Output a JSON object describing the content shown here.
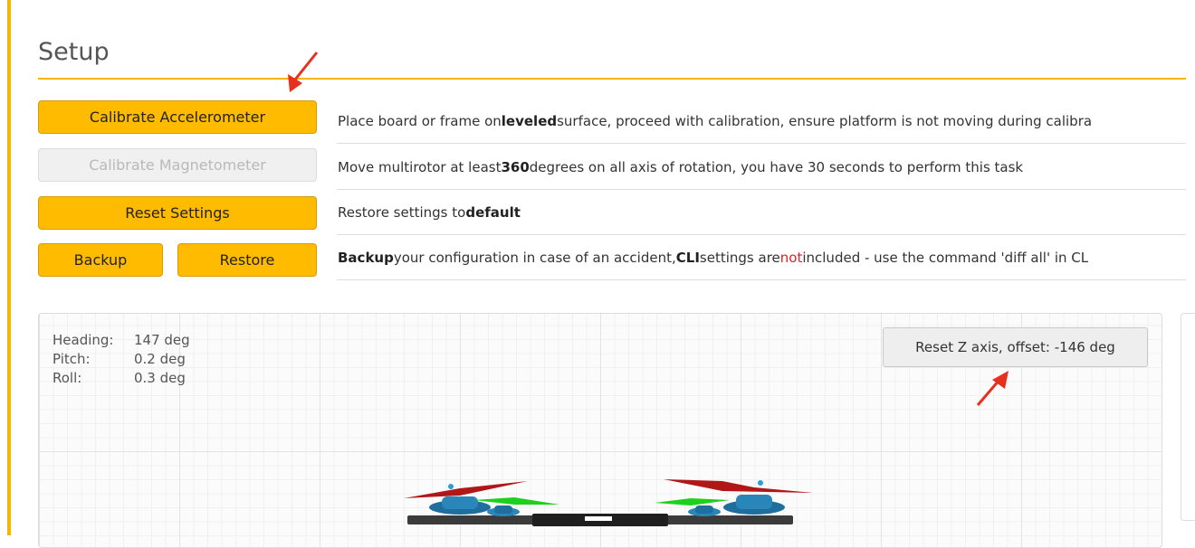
{
  "page": {
    "title": "Setup"
  },
  "buttons": {
    "calibrate_accel": "Calibrate Accelerometer",
    "calibrate_mag": "Calibrate Magnetometer",
    "reset_settings": "Reset Settings",
    "backup": "Backup",
    "restore": "Restore"
  },
  "descriptions": {
    "accel": {
      "pre": "Place board or frame on ",
      "bold": "leveled",
      "post": " surface, proceed with calibration, ensure platform is not moving during calibra"
    },
    "mag": {
      "pre": "Move multirotor at least ",
      "bold": "360",
      "post": " degrees on all axis of rotation, you have 30 seconds to perform this task"
    },
    "reset": {
      "pre": "Restore settings to ",
      "bold": "default"
    },
    "backup": {
      "bold1": "Backup",
      "mid1": " your configuration in case of an accident, ",
      "bold2": "CLI",
      "mid2": " settings are ",
      "red": "not",
      "post": " included - use the command 'diff all' in CL"
    }
  },
  "attitude": {
    "heading_label": "Heading:",
    "heading_value": "147 deg",
    "pitch_label": "Pitch:",
    "pitch_value": "0.2 deg",
    "roll_label": "Roll:",
    "roll_value": "0.3 deg"
  },
  "reset_z_label": "Reset Z axis, offset: -146 deg",
  "colors": {
    "accent": "#ffbb00",
    "annotation_arrow": "#e8301e"
  }
}
